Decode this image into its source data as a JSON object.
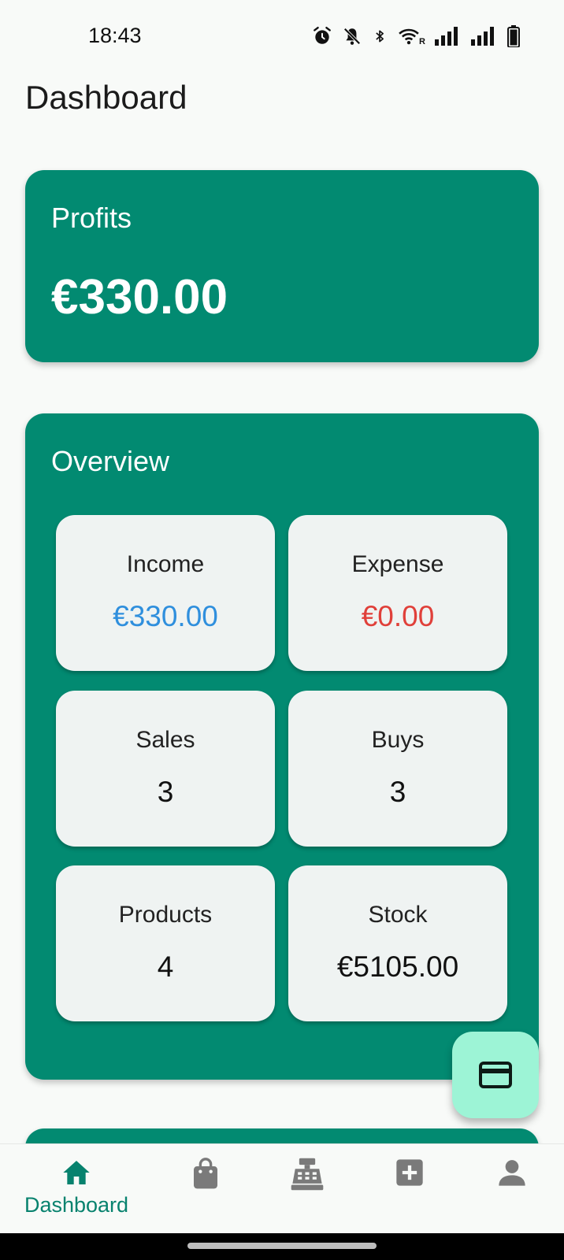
{
  "status_bar": {
    "time": "18:43",
    "icons": [
      "alarm-icon",
      "bell-off-icon",
      "bluetooth-icon",
      "wifi-icon",
      "signal-roaming-icon",
      "signal-icon",
      "battery-icon"
    ],
    "roaming_letter": "R"
  },
  "page": {
    "title": "Dashboard"
  },
  "profits": {
    "title": "Profits",
    "value": "€330.00"
  },
  "overview": {
    "title": "Overview",
    "tiles": [
      {
        "label": "Income",
        "value": "€330.00"
      },
      {
        "label": "Expense",
        "value": "€0.00"
      },
      {
        "label": "Sales",
        "value": "3"
      },
      {
        "label": "Buys",
        "value": "3"
      },
      {
        "label": "Products",
        "value": "4"
      },
      {
        "label": "Stock",
        "value": "€5105.00"
      }
    ]
  },
  "fab": {
    "icon": "credit-card-icon"
  },
  "bottom_nav": {
    "active_label": "Dashboard",
    "items": [
      {
        "icon": "home-icon",
        "active": true
      },
      {
        "icon": "shopping-bag-icon",
        "active": false
      },
      {
        "icon": "cash-register-icon",
        "active": false
      },
      {
        "icon": "add-box-icon",
        "active": false
      },
      {
        "icon": "person-icon",
        "active": false
      }
    ]
  },
  "colors": {
    "card": "#028a71",
    "tile": "#eff3f2",
    "income": "#2f8fdd",
    "expense": "#e0403a",
    "fab": "#9df4d6",
    "nav_active": "#07826e",
    "nav_inactive": "#7a7a7a",
    "background": "#f8faf8"
  }
}
